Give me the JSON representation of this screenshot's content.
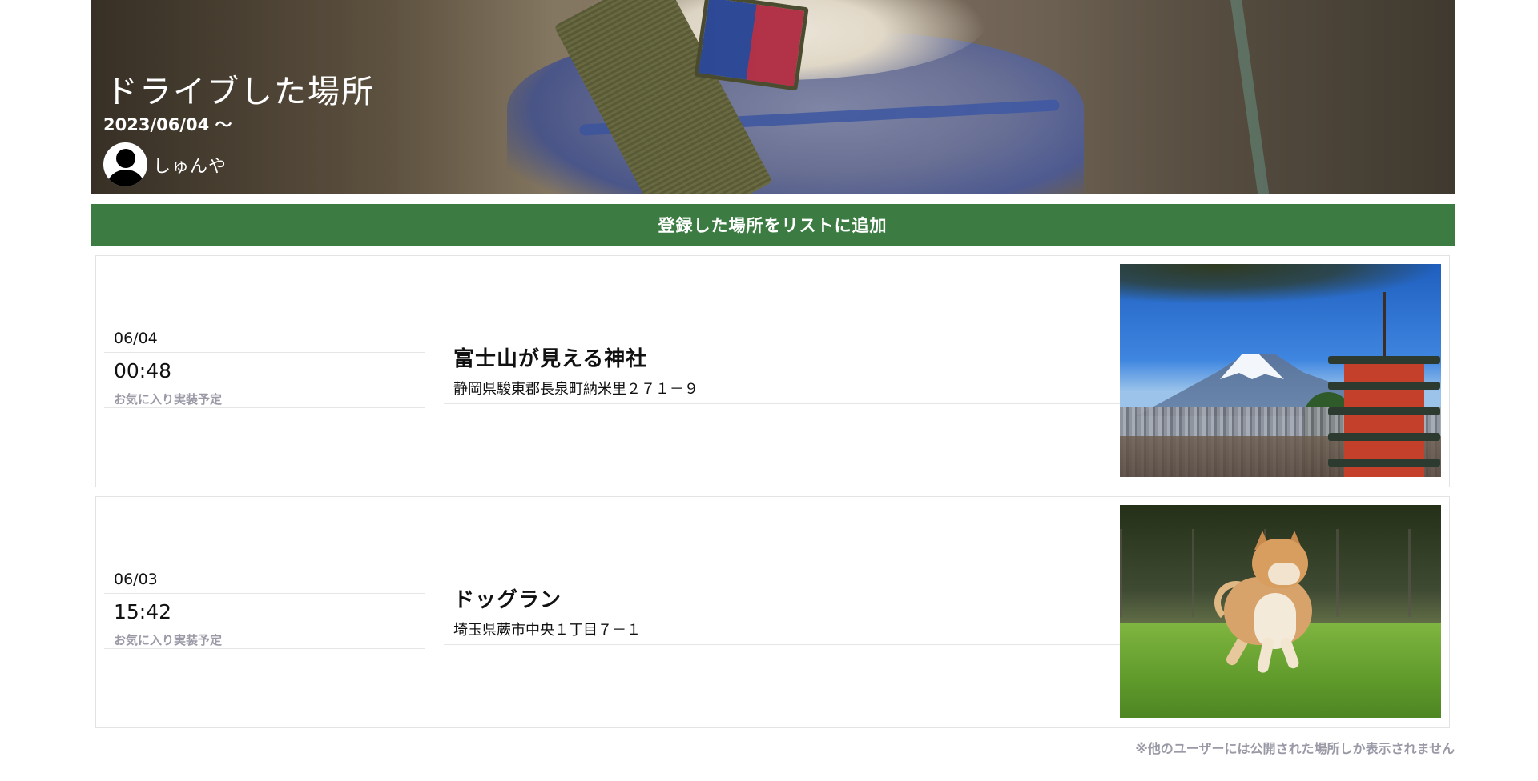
{
  "header": {
    "title": "ドライブした場所",
    "date": "2023/06/04 〜",
    "user": {
      "name": "しゅんや"
    }
  },
  "add_button_label": "登録した場所をリストに追加",
  "entries": [
    {
      "date": "06/04",
      "time": "00:48",
      "favorite_note": "お気に入り実装予定",
      "name": "富士山が見える神社",
      "address": "静岡県駿東郡長泉町納米里２７１－９",
      "image": "fuji-pagoda-photo"
    },
    {
      "date": "06/03",
      "time": "15:42",
      "favorite_note": "お気に入り実装予定",
      "name": "ドッグラン",
      "address": "埼玉県蕨市中央１丁目７－１",
      "image": "shiba-dog-photo"
    }
  ],
  "footnote": "※他のユーザーには公開された場所しか表示されません",
  "colors": {
    "button_green": "#3c7c43",
    "muted_text": "#999aa6"
  }
}
